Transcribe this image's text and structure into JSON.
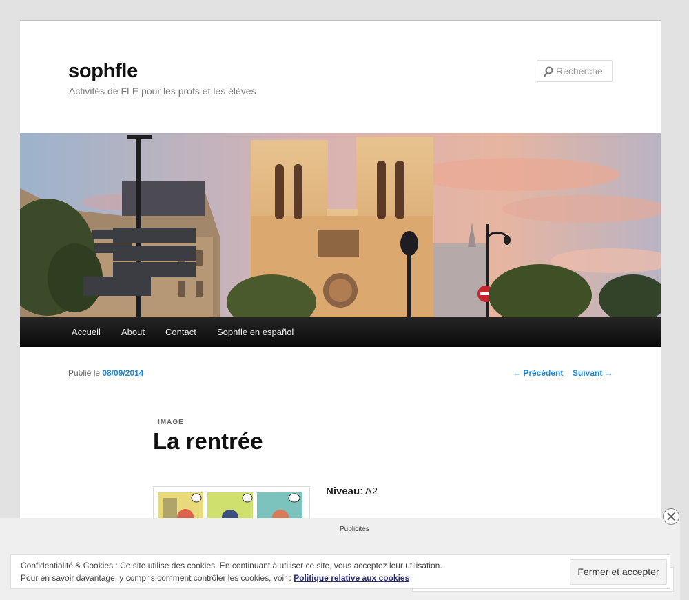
{
  "site": {
    "title": "sophfle",
    "description": "Activités de FLE pour les profs et les élèves"
  },
  "search": {
    "placeholder": "Recherche"
  },
  "nav": {
    "items": [
      {
        "label": "Accueil"
      },
      {
        "label": "About"
      },
      {
        "label": "Contact"
      },
      {
        "label": "Sophfle en español"
      }
    ]
  },
  "post": {
    "published_prefix": "Publié le",
    "date": "08/09/2014",
    "prev_label": "← Précédent",
    "next_label": "Suivant →",
    "format": "IMAGE",
    "title": "La rentrée",
    "level_label": "Niveau",
    "level_value": "A2"
  },
  "ads": {
    "label": "Publicités"
  },
  "cookie": {
    "line1": "Confidentialité & Cookies : Ce site utilise des cookies. En continuant à utiliser ce site, vous acceptez leur utilisation.",
    "line2_prefix": "Pour en savoir davantage, y compris comment contrôler les cookies, voir :",
    "policy_link": "Politique relative aux cookies",
    "accept_label": "Fermer et accepter"
  },
  "colors": {
    "link": "#1b8be0",
    "nav_bg": "#161616",
    "page_bg": "#e2e2e2"
  }
}
